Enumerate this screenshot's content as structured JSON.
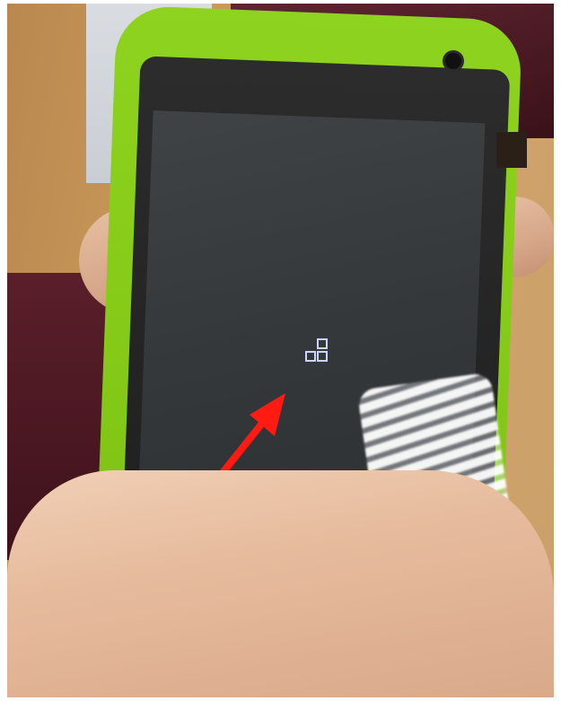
{
  "scene": {
    "subject": "hands-holding-phone",
    "colors": {
      "phone_body": "#86cc18",
      "screen": "#34383a",
      "arrow": "#ff1a12",
      "boot_logo": "#c9d5ff"
    },
    "icons": [
      "boot-logo-icon",
      "red-arrow"
    ]
  }
}
